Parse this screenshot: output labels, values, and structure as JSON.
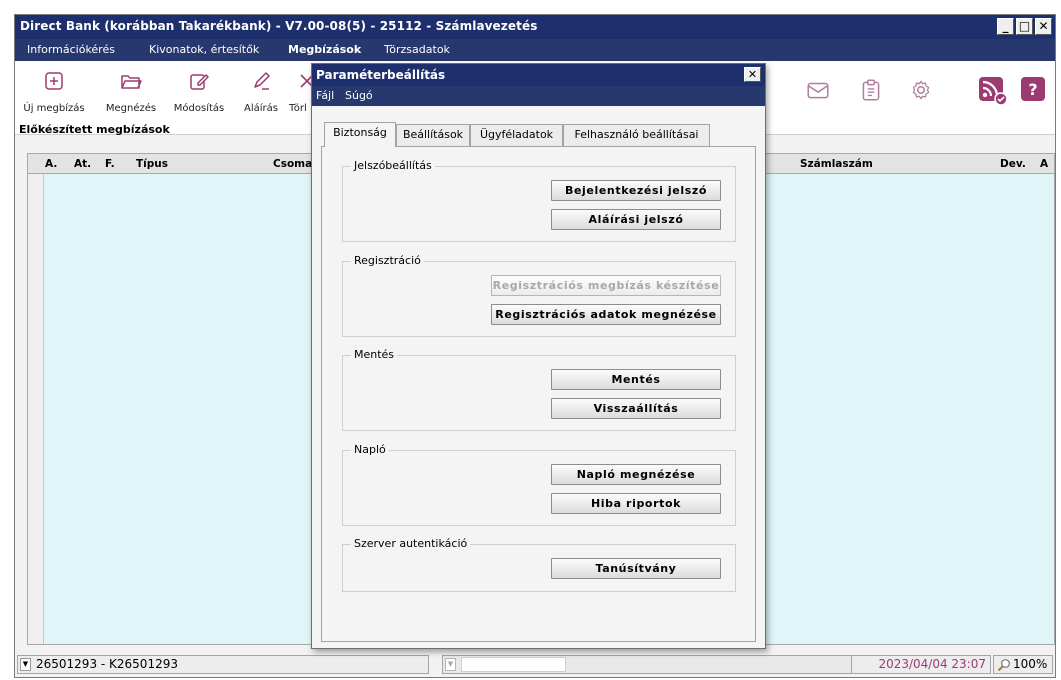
{
  "window": {
    "title": "Direct Bank (korábban Takarékbank) - V7.00-08(5) - 25112 - Számlavezetés"
  },
  "menu": [
    {
      "label": "Információkérés"
    },
    {
      "label": "Kivonatok, értesítők"
    },
    {
      "label": "Megbízások",
      "active": true
    },
    {
      "label": "Törzsadatok"
    }
  ],
  "toolbar": {
    "new_label": "Új megbízás",
    "view_label": "Megnézés",
    "edit_label": "Módosítás",
    "sign_label": "Aláírás",
    "delete_label": "Törl"
  },
  "section_title": "Előkészített megbízások",
  "grid": {
    "columns": [
      "A.",
      "At.",
      "F.",
      "Típus",
      "Csoma",
      "Számlaszám",
      "Dev.",
      "A"
    ]
  },
  "status": {
    "account": "26501293 - K26501293",
    "datetime": "2023/04/04 23:07",
    "zoom": "100%",
    "datetime_color": "#9c3b72"
  },
  "dialog": {
    "title": "Paraméterbeállítás",
    "menu": [
      "Fájl",
      "Súgó"
    ],
    "tabs": [
      "Biztonság",
      "Beállítások",
      "Ügyféladatok",
      "Felhasználó beállításai"
    ],
    "groups": [
      {
        "label": "Jelszóbeállítás",
        "buttons": [
          {
            "label": "Bejelentkezési jelszó"
          },
          {
            "label": "Aláírási jelszó"
          }
        ]
      },
      {
        "label": "Regisztráció",
        "buttons": [
          {
            "label": "Regisztrációs megbízás készítése",
            "disabled": true
          },
          {
            "label": "Regisztrációs adatok megnézése"
          }
        ]
      },
      {
        "label": "Mentés",
        "buttons": [
          {
            "label": "Mentés"
          },
          {
            "label": "Visszaállítás"
          }
        ]
      },
      {
        "label": "Napló",
        "buttons": [
          {
            "label": "Napló megnézése"
          },
          {
            "label": "Hiba riportok"
          }
        ]
      },
      {
        "label": "Szerver autentikáció",
        "buttons": [
          {
            "label": "Tanúsítvány"
          }
        ]
      }
    ]
  },
  "colors": {
    "accent": "#9c3b72",
    "titlebar": "#1e2f6e",
    "grid_bg": "#e0f5f8"
  },
  "icons": [
    "plus-square-icon",
    "folder-open-icon",
    "edit-icon",
    "pencil-icon",
    "close-icon",
    "mail-icon",
    "clipboard-icon",
    "gear-icon",
    "rss-check-icon",
    "help-icon",
    "magnifier-icon"
  ]
}
